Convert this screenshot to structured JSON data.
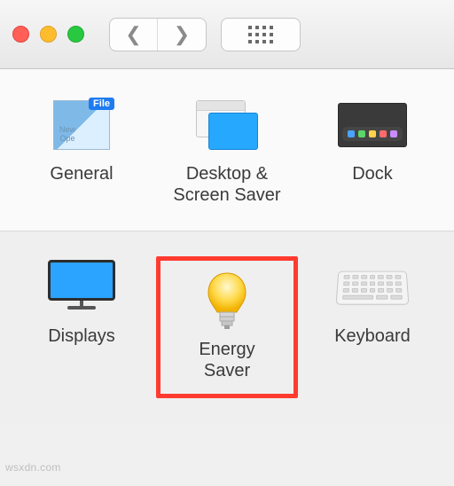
{
  "toolbar": {
    "back_aria": "Back",
    "fwd_aria": "Forward",
    "grid_aria": "Show All"
  },
  "panels": {
    "row1": [
      {
        "key": "general",
        "label": "General",
        "badge": "File"
      },
      {
        "key": "desktop",
        "label": "Desktop &\nScreen Saver"
      },
      {
        "key": "dock",
        "label": "Dock"
      }
    ],
    "row2": [
      {
        "key": "displays",
        "label": "Displays"
      },
      {
        "key": "energy",
        "label": "Energy\nSaver",
        "highlighted": true
      },
      {
        "key": "keyboard",
        "label": "Keyboard"
      }
    ]
  },
  "dock_colors": [
    "#4aa3ff",
    "#5bd769",
    "#ffd24a",
    "#ff6b6b",
    "#c98cff"
  ],
  "attribution": "wsxdn.com"
}
